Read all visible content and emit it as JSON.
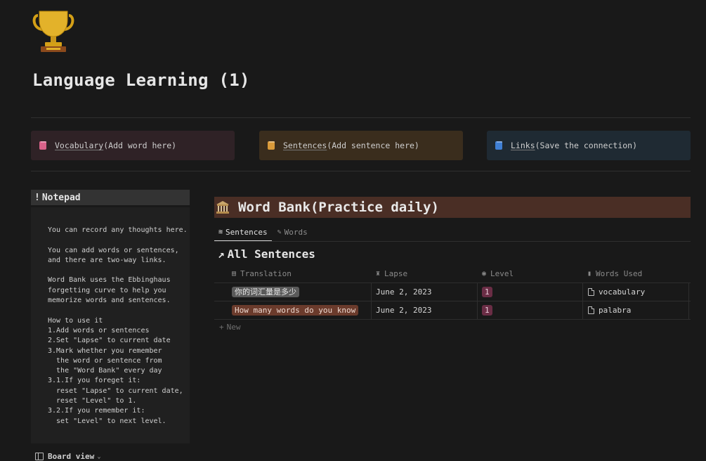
{
  "page": {
    "title": "Language Learning (1)",
    "icon": "trophy-icon"
  },
  "callouts": [
    {
      "icon": "book-pink-icon",
      "link": "Vocabulary",
      "text": "(Add word here)",
      "color": "#d9628a"
    },
    {
      "icon": "book-orange-icon",
      "link": "Sentences",
      "text": "(Add sentence here)",
      "color": "#d99a3a"
    },
    {
      "icon": "book-blue-icon",
      "link": "Links",
      "text": "(Save the connection)",
      "color": "#3f7fd4"
    }
  ],
  "notepad": {
    "bang": "!",
    "title": "Notepad",
    "body": "You can record any thoughts here.\n\nYou can add words or sentences,\nand there are two-way links.\n\nWord Bank uses the Ebbinghaus\nforgetting curve to help you\nmemorize words and sentences.\n\nHow to use it\n1.Add words or sentences\n2.Set \"Lapse\" to current date\n3.Mark whether you remember\n  the word or sentence from\n  the \"Word Bank\" every day\n3.1.If you foreget it:\n  reset \"Lapse\" to current date,\n  reset \"Level\" to 1.\n3.2.If you remember it:\n  set \"Level\" to next level."
  },
  "board_view": {
    "label": "Board view",
    "chevron": "⌄"
  },
  "word_bank": {
    "icon": "bank-icon",
    "title": "Word Bank(Practice daily)"
  },
  "tabs": [
    {
      "label": "Sentences",
      "icon": "≋",
      "active": true
    },
    {
      "label": "Words",
      "icon": "✎",
      "active": false
    }
  ],
  "table": {
    "arrow": "↗",
    "title": "All Sentences",
    "columns": [
      {
        "label": "Translation",
        "icon": "▤"
      },
      {
        "label": "Lapse",
        "icon": "♜"
      },
      {
        "label": "Level",
        "icon": "◉"
      },
      {
        "label": "Words Used",
        "icon": "▮"
      }
    ],
    "rows": [
      {
        "translation": "你的词汇量是多少",
        "lapse": "June 2, 2023",
        "level": "1",
        "word": "vocabulary"
      },
      {
        "translation": "How many words do you know",
        "lapse": "June 2, 2023",
        "level": "1",
        "word": "palabra"
      }
    ],
    "new_plus": "+",
    "new_label": "New"
  }
}
